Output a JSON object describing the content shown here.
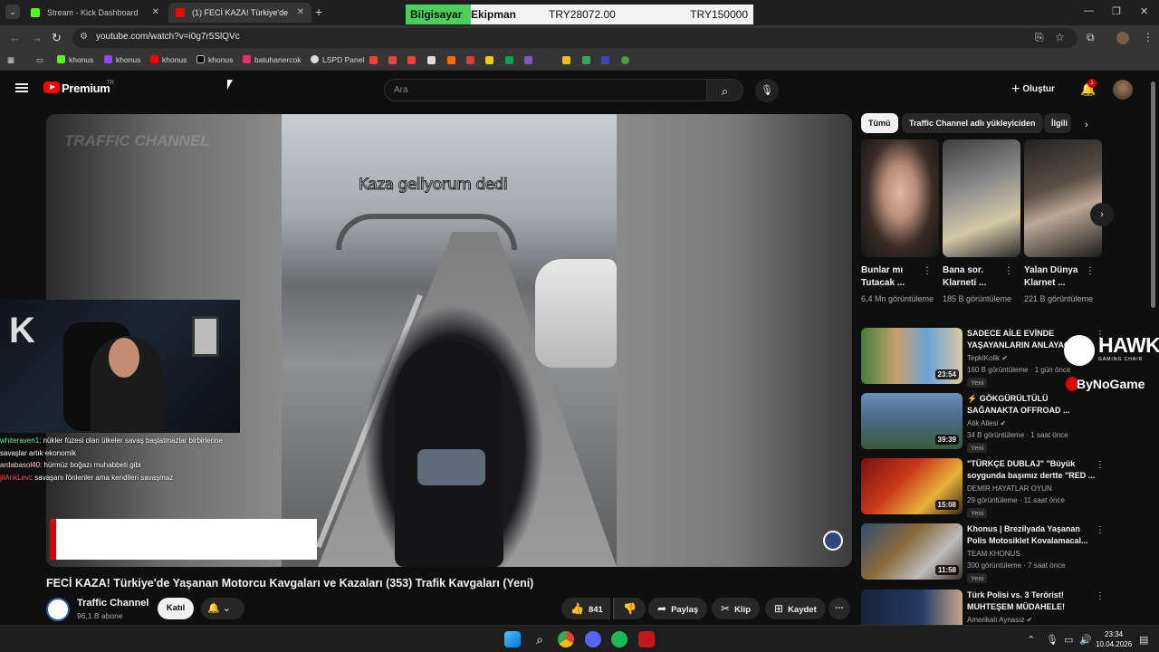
{
  "browser": {
    "tabs": [
      {
        "label": "Stream - Kick Dashboard",
        "color": "#53fc18"
      },
      {
        "label": "(1) FECİ KAZA! Türkiye'de Yaşan",
        "color": "#ff0000"
      }
    ],
    "url": "youtube.com/watch?v=i0g7r5SlQVc",
    "bookmarks": [
      {
        "label": "khonus",
        "color": "#53fc18"
      },
      {
        "label": "khonus",
        "color": "#9146ff"
      },
      {
        "label": "khonus",
        "color": "#ff0000"
      },
      {
        "label": "khonus",
        "color": "#ffffff"
      },
      {
        "label": "batuhanercok",
        "color": "#e1306c"
      },
      {
        "label": "LSPD Panel",
        "color": "#dddddd"
      }
    ]
  },
  "overlay": {
    "category_a": "Bilgisayar ve",
    "category_b": "Ekipman",
    "price_1": "TRY28072.00",
    "price_2": "TRY150000"
  },
  "youtube": {
    "logo_text": "Premium",
    "country": "TR",
    "search_placeholder": "Ara",
    "create_label": "Oluştur",
    "notification_count": "1"
  },
  "player": {
    "caption": "Kaza geliyorum dedi",
    "watermark": "TRAFFIC CHANNEL"
  },
  "stream_chat": [
    {
      "user": "whiteraven1",
      "msg": ": nükler füzesi olan ülkeler savaş başlatmazlar birbirlerine savaşlar artık ekonomik"
    },
    {
      "user": "ardabasol40",
      "msg": ": hürmüz boğazı muhabbeti gibi"
    },
    {
      "user": "jilAnkLevi",
      "msg": ": savaşanı fönlenler ama kendileri savaşmaz"
    }
  ],
  "video": {
    "title": "FECİ KAZA! Türkiye'de Yaşanan Motorcu Kavgaları ve Kazaları (353) Trafik Kavgaları (Yeni)",
    "channel": "Traffic Channel",
    "subscribers": "96,1 B abone",
    "join_label": "Katıl",
    "likes": "841",
    "share_label": "Paylaş",
    "clip_label": "Klip",
    "save_label": "Kaydet"
  },
  "chips": [
    {
      "label": "Tümü"
    },
    {
      "label": "Traffic Channel adlı yükleyiciden"
    },
    {
      "label": "İlgili"
    }
  ],
  "shorts": [
    {
      "title": "Bunlar mı Tutacak ...",
      "views": "6,4 Mn görüntüleme"
    },
    {
      "title": "Bana sor. Klarneti ...",
      "views": "185 B görüntüleme"
    },
    {
      "title": "Yalan Dünya Klarnet ...",
      "views": "221 B görüntüleme"
    }
  ],
  "recommendations": [
    {
      "title": "SADECE AİLE EVİNDE YAŞAYANLARIN ANLAYACAĞI",
      "channel": "TepkiKolik",
      "views": "160 B görüntüleme · 1 gün önce",
      "badge": "Yeni",
      "duration": "23:54"
    },
    {
      "title": "⚡ GÖKGÜRÜLTÜLÜ SAĞANAKTA OFFROAD ...",
      "channel": "Atik Ailesi",
      "views": "34 B görüntüleme · 1 saat önce",
      "badge": "Yeni",
      "duration": "39:39"
    },
    {
      "title": "\"TÜRKÇE DUBLAJ\" \"Büyük soygunda başımız dertte \"RED ...",
      "channel": "DEMİR HAYATLAR OYUN",
      "views": "29 görüntüleme · 11 saat önce",
      "badge": "Yeni",
      "duration": "15:08"
    },
    {
      "title": "Khonus | Brezilyada Yaşanan Polis Motosiklet Kovalamacal...",
      "channel": "TEAM KHONUS",
      "views": "300 görüntüleme · 7 saat önce",
      "badge": "Yeni",
      "duration": "11:58"
    },
    {
      "title": "Türk Polisi vs. 3 Terörist! MUHTEŞEM MÜDAHELE!",
      "channel": "Amerikalı Aynasız",
      "views": "",
      "badge": "",
      "duration": ""
    }
  ],
  "sponsor": {
    "brand": "HAWK",
    "tagline": "GAMING CHAIR",
    "partner": "ByNoGame"
  },
  "taskbar": {
    "time": "23:34",
    "date": "10.04.2026"
  }
}
